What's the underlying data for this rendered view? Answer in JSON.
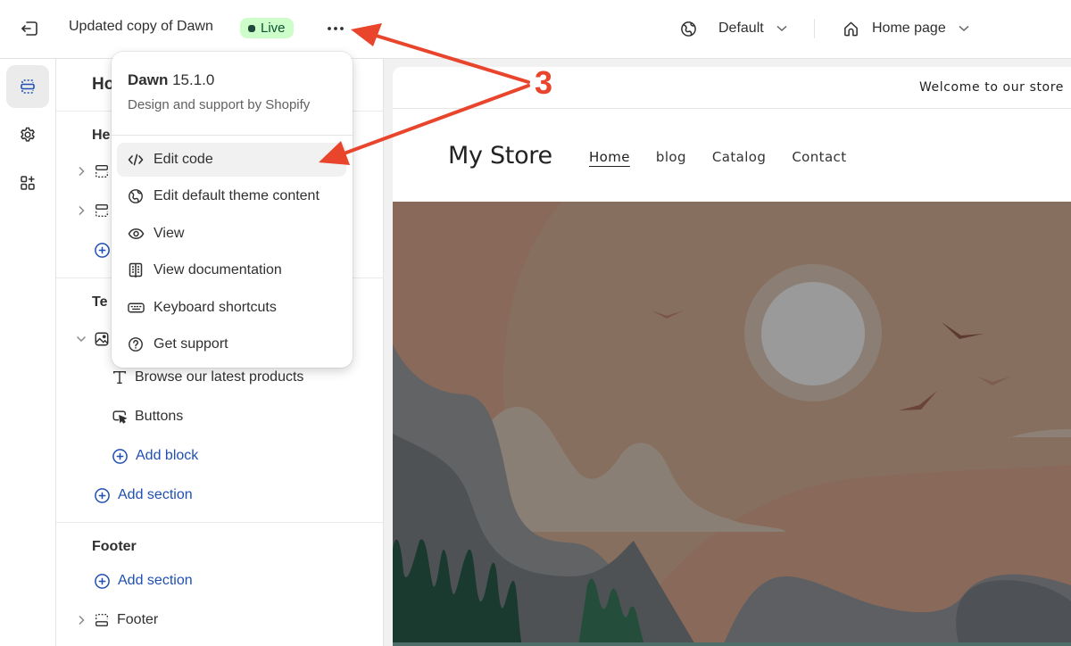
{
  "topbar": {
    "theme_name": "Updated copy of Dawn",
    "status_badge": "Live",
    "more_label": "•••",
    "market_selector": {
      "icon": "globe-icon",
      "label": "Default"
    },
    "page_selector": {
      "icon": "home-icon",
      "label": "Home page"
    }
  },
  "rail": {
    "items": [
      {
        "name": "sections",
        "icon": "sections-icon",
        "active": true
      },
      {
        "name": "theme-settings",
        "icon": "gear-icon",
        "active": false
      },
      {
        "name": "app-embeds",
        "icon": "apps-add-icon",
        "active": false
      }
    ]
  },
  "panel": {
    "title": "Ho",
    "header_group": "He",
    "template_group": "Te",
    "template_blocks": [
      {
        "icon": "text-icon",
        "label": "Browse our latest products"
      },
      {
        "icon": "button-cursor-icon",
        "label": "Buttons"
      }
    ],
    "add_block": "Add block",
    "add_section_template": "Add section",
    "footer_group": "Footer",
    "add_section_footer": "Add section",
    "footer_item": "Footer"
  },
  "menu": {
    "theme_name": "Dawn",
    "theme_version": "15.1.0",
    "subtitle": "Design and support by Shopify",
    "items": [
      {
        "icon": "code-icon",
        "label": "Edit code",
        "highlighted": true
      },
      {
        "icon": "globe-icon",
        "label": "Edit default theme content",
        "highlighted": false
      },
      {
        "icon": "eye-icon",
        "label": "View",
        "highlighted": false
      },
      {
        "icon": "book-icon",
        "label": "View documentation",
        "highlighted": false
      },
      {
        "icon": "keyboard-icon",
        "label": "Keyboard shortcuts",
        "highlighted": false
      },
      {
        "icon": "question-circle-icon",
        "label": "Get support",
        "highlighted": false
      }
    ]
  },
  "preview": {
    "announcement": "Welcome to our store",
    "store_name": "My Store",
    "nav": [
      {
        "label": "Home",
        "active": true
      },
      {
        "label": "blog",
        "active": false
      },
      {
        "label": "Catalog",
        "active": false
      },
      {
        "label": "Contact",
        "active": false
      }
    ]
  },
  "annotation": {
    "step_number": "3",
    "color": "#e8452c"
  }
}
